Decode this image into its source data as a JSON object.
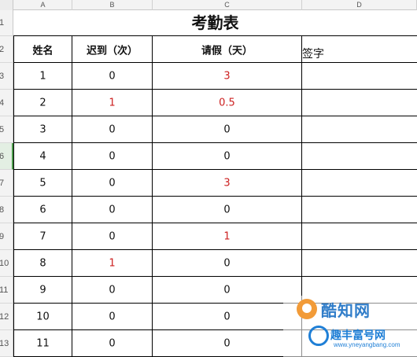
{
  "column_headers": [
    "A",
    "B",
    "C",
    "D"
  ],
  "row_headers": [
    "1",
    "2",
    "3",
    "4",
    "5",
    "6",
    "7",
    "8",
    "9",
    "10",
    "11",
    "12",
    "13"
  ],
  "title": "考勤表",
  "table_headers": {
    "name": "姓名",
    "late": "迟到（次）",
    "leave": "请假（天）",
    "sign": "签字"
  },
  "rows": [
    {
      "name": "1",
      "late": "0",
      "leave": "3"
    },
    {
      "name": "2",
      "late": "1",
      "leave": "0.5"
    },
    {
      "name": "3",
      "late": "0",
      "leave": "0"
    },
    {
      "name": "4",
      "late": "0",
      "leave": "0"
    },
    {
      "name": "5",
      "late": "0",
      "leave": "3"
    },
    {
      "name": "6",
      "late": "0",
      "leave": "0"
    },
    {
      "name": "7",
      "late": "0",
      "leave": "1"
    },
    {
      "name": "8",
      "late": "1",
      "leave": "0"
    },
    {
      "name": "9",
      "late": "0",
      "leave": "0"
    },
    {
      "name": "10",
      "late": "0",
      "leave": "0"
    },
    {
      "name": "11",
      "late": "0",
      "leave": "0"
    }
  ],
  "highlight_color": "#cc1f1f",
  "watermark": {
    "text1": "酷知网",
    "text2": "趣丰富号网",
    "url": "www.yneyangbang.com"
  }
}
